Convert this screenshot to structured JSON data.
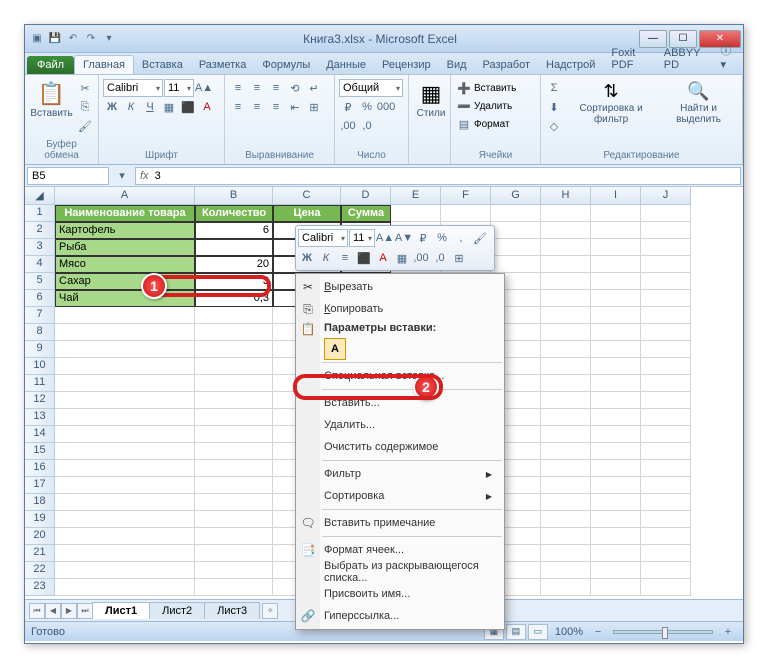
{
  "window": {
    "title": "Книга3.xlsx - Microsoft Excel"
  },
  "tabs": {
    "file": "Файл",
    "items": [
      "Главная",
      "Вставка",
      "Разметка",
      "Формулы",
      "Данные",
      "Рецензир",
      "Вид",
      "Разработ",
      "Надстрой",
      "Foxit PDF",
      "ABBYY PD"
    ],
    "active": 0
  },
  "ribbon": {
    "clipboard": {
      "paste": "Вставить",
      "label": "Буфер обмена"
    },
    "font": {
      "name": "Calibri",
      "size": "11",
      "label": "Шрифт"
    },
    "align": {
      "label": "Выравнивание"
    },
    "number": {
      "format": "Общий",
      "label": "Число"
    },
    "styles": {
      "btn": "Стили"
    },
    "cells": {
      "insert": "Вставить",
      "delete": "Удалить",
      "format": "Формат",
      "label": "Ячейки"
    },
    "editing": {
      "sort": "Сортировка и фильтр",
      "find": "Найти и выделить",
      "label": "Редактирование"
    }
  },
  "namebox": "B5",
  "formula": "3",
  "columns": [
    "A",
    "B",
    "C",
    "D",
    "E",
    "F",
    "G",
    "H",
    "I",
    "J"
  ],
  "headers": {
    "a": "Наименование товара",
    "b": "Количество",
    "c": "Цена",
    "d": "Сумма"
  },
  "rows": [
    {
      "a": "Картофель",
      "b": "6"
    },
    {
      "a": "Рыба",
      "b": ""
    },
    {
      "a": "Мясо",
      "b": "20"
    },
    {
      "a": "Сахар",
      "b": "3"
    },
    {
      "a": "Чай",
      "b": "0,3"
    }
  ],
  "minitb": {
    "font": "Calibri",
    "size": "11"
  },
  "ctx": {
    "cut": "Вырезать",
    "copy": "Копировать",
    "pasteopts": "Параметры вставки:",
    "pastespecial": "Специальная вставка...",
    "insert": "Вставить...",
    "delete": "Удалить...",
    "clear": "Очистить содержимое",
    "filter": "Фильтр",
    "sort": "Сортировка",
    "comment": "Вставить примечание",
    "format": "Формат ячеек...",
    "dropdown": "Выбрать из раскрывающегося списка...",
    "name": "Присвоить имя...",
    "hyperlink": "Гиперссылка..."
  },
  "sheets": [
    "Лист1",
    "Лист2",
    "Лист3"
  ],
  "status": {
    "ready": "Готово",
    "zoom": "100%"
  },
  "badges": {
    "one": "1",
    "two": "2"
  }
}
